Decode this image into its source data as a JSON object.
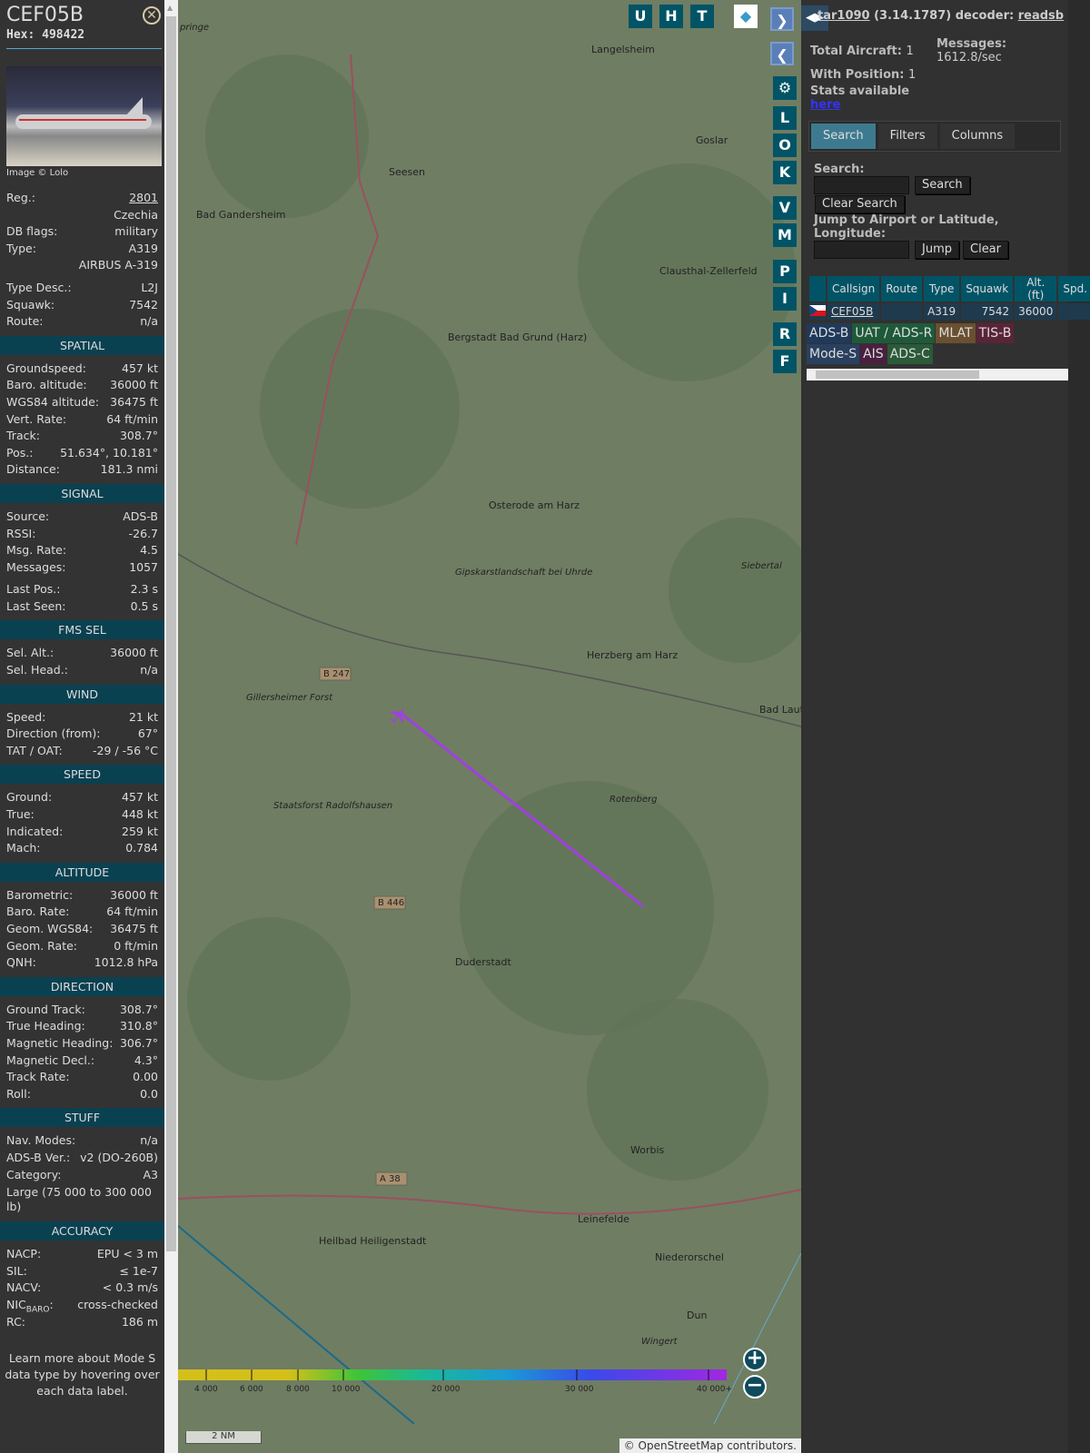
{
  "selected": {
    "callsign": "CEF05B",
    "hex_label": "Hex:",
    "hex": "498422",
    "image_credit": "Image © Lolo",
    "sections": [
      {
        "title": null,
        "rows": [
          {
            "label": "Reg.:",
            "value": "2801",
            "link": true
          },
          {
            "label": "",
            "value": "Czechia"
          },
          {
            "label": "DB flags:",
            "value": "military"
          },
          {
            "label": "Type:",
            "value": "A319"
          },
          {
            "label": "",
            "value": "AIRBUS A-319",
            "gap": true
          },
          {
            "label": "Type Desc.:",
            "value": "L2J"
          },
          {
            "label": "Squawk:",
            "value": "7542"
          },
          {
            "label": "Route:",
            "value": "n/a"
          }
        ]
      },
      {
        "title": "SPATIAL",
        "rows": [
          {
            "label": "Groundspeed:",
            "value": "457 kt"
          },
          {
            "label": "Baro. altitude:",
            "value": "36000 ft"
          },
          {
            "label": "WGS84 altitude:",
            "value": "36475 ft"
          },
          {
            "label": "Vert. Rate:",
            "value": "64 ft/min"
          },
          {
            "label": "Track:",
            "value": "308.7°"
          },
          {
            "label": "Pos.:",
            "value": "51.634°, 10.181°"
          },
          {
            "label": "Distance:",
            "value": "181.3 nmi"
          }
        ]
      },
      {
        "title": "SIGNAL",
        "rows": [
          {
            "label": "Source:",
            "value": "ADS-B"
          },
          {
            "label": "RSSI:",
            "value": "-26.7"
          },
          {
            "label": "Msg. Rate:",
            "value": "4.5"
          },
          {
            "label": "Messages:",
            "value": "1057",
            "gap": true
          },
          {
            "label": "Last Pos.:",
            "value": "2.3 s"
          },
          {
            "label": "Last Seen:",
            "value": "0.5 s"
          }
        ]
      },
      {
        "title": "FMS SEL",
        "rows": [
          {
            "label": "Sel. Alt.:",
            "value": "36000 ft"
          },
          {
            "label": "Sel. Head.:",
            "value": "n/a"
          }
        ]
      },
      {
        "title": "WIND",
        "rows": [
          {
            "label": "Speed:",
            "value": "21 kt"
          },
          {
            "label": "Direction (from):",
            "value": "67°"
          },
          {
            "label": "TAT / OAT:",
            "value": "-29 / -56 °C"
          }
        ]
      },
      {
        "title": "SPEED",
        "rows": [
          {
            "label": "Ground:",
            "value": "457 kt"
          },
          {
            "label": "True:",
            "value": "448 kt"
          },
          {
            "label": "Indicated:",
            "value": "259 kt"
          },
          {
            "label": "Mach:",
            "value": "0.784"
          }
        ]
      },
      {
        "title": "ALTITUDE",
        "rows": [
          {
            "label": "Barometric:",
            "value": "36000 ft"
          },
          {
            "label": "Baro. Rate:",
            "value": "64 ft/min"
          },
          {
            "label": "Geom. WGS84:",
            "value": "36475 ft"
          },
          {
            "label": "Geom. Rate:",
            "value": "0 ft/min"
          },
          {
            "label": "QNH:",
            "value": "1012.8 hPa"
          }
        ]
      },
      {
        "title": "DIRECTION",
        "rows": [
          {
            "label": "Ground Track:",
            "value": "308.7°"
          },
          {
            "label": "True Heading:",
            "value": "310.8°"
          },
          {
            "label": "Magnetic Heading:",
            "value": "306.7°"
          },
          {
            "label": "Magnetic Decl.:",
            "value": "4.3°"
          },
          {
            "label": "Track Rate:",
            "value": "0.00"
          },
          {
            "label": "Roll:",
            "value": "0.0"
          }
        ]
      },
      {
        "title": "STUFF",
        "rows": [
          {
            "label": "Nav. Modes:",
            "value": "n/a"
          },
          {
            "label": "ADS-B Ver.:",
            "value": "v2 (DO-260B)"
          },
          {
            "label": "Category:",
            "value": "A3"
          },
          {
            "label": "Large (75 000 to 300 000 lb)",
            "value": "",
            "wrap": true
          }
        ]
      },
      {
        "title": "ACCURACY",
        "rows": [
          {
            "label": "NACP:",
            "value": "EPU < 3 m"
          },
          {
            "label": "SIL:",
            "value": "≤ 1e-7"
          },
          {
            "label": "NACV:",
            "value": "< 0.3 m/s"
          },
          {
            "label": "NICBARO:",
            "value": "cross-checked"
          },
          {
            "label": "RC:",
            "value": "186 m"
          }
        ]
      }
    ],
    "learn_more": "Learn more about Mode S data type by hovering over each data label."
  },
  "map": {
    "buttons": [
      "U",
      "H",
      "T"
    ],
    "side_buttons": [
      "L",
      "O",
      "K",
      "V",
      "M",
      "P",
      "I",
      "R",
      "F"
    ],
    "towns": [
      "Langelsheim",
      "Goslar",
      "Seesen",
      "Bad Gandersheim",
      "Bergstadt Bad Grund (Harz)",
      "Clausthal-Zellerfeld",
      "Osterode am Harz",
      "Herzberg am Harz",
      "Bad Lauterberg im Harz",
      "Duderstadt",
      "Worbis",
      "Leinefelde",
      "Heilbad Heiligenstadt",
      "Niederorschel",
      "Dun",
      "Wingert",
      "Gillersheimer Forst",
      "Staatsforst Radolfshausen",
      "Rotenberg",
      "Siebertal",
      "Gipskarstlandschaft bei Uhrde",
      "pringe"
    ],
    "roads": [
      "B 247",
      "B 446",
      "A 38"
    ],
    "altitude_scale": [
      "4 000",
      "6 000",
      "8 000",
      "10 000",
      "20 000",
      "30 000",
      "40 000+"
    ],
    "scale_label": "2 NM",
    "attribution": "© OpenStreetMap contributors.",
    "track_color": "#a040e0"
  },
  "sidebar": {
    "title_link": "tar1090",
    "title_version": " (3.14.1787) decoder: ",
    "decoder_link": "readsb",
    "total_label": "Total Aircraft:",
    "total": "1",
    "with_pos_label": "With Position:",
    "with_pos": "1",
    "messages_label": "Messages:",
    "messages": "1612.8/sec",
    "stats_label": "Stats available",
    "stats_link": "here",
    "tabs": [
      "Search",
      "Filters",
      "Columns"
    ],
    "search_label": "Search:",
    "search_button": "Search",
    "clear_search_button": "Clear Search",
    "jump_label": "Jump to Airport or Latitude, Longitude:",
    "jump_button": "Jump",
    "clear_button": "Clear",
    "table": {
      "columns": [
        "",
        "Callsign",
        "Route",
        "Type",
        "Squawk",
        "Alt. (ft)",
        "Spd."
      ],
      "rows": [
        {
          "callsign": "CEF05B",
          "route": "",
          "type": "A319",
          "squawk": "7542",
          "alt": "36000"
        }
      ]
    },
    "legend": [
      {
        "label": "ADS-B",
        "color": "#1f3a5a"
      },
      {
        "label": "UAT / ADS-R",
        "color": "#1e5a3a"
      },
      {
        "label": "MLAT",
        "color": "#6a5030"
      },
      {
        "label": "TIS-B",
        "color": "#5a2438"
      },
      {
        "label": "Mode-S",
        "color": "#2a4060"
      },
      {
        "label": "AIS",
        "color": "#4a2040"
      },
      {
        "label": "ADS-C",
        "color": "#2a5a38"
      }
    ]
  }
}
